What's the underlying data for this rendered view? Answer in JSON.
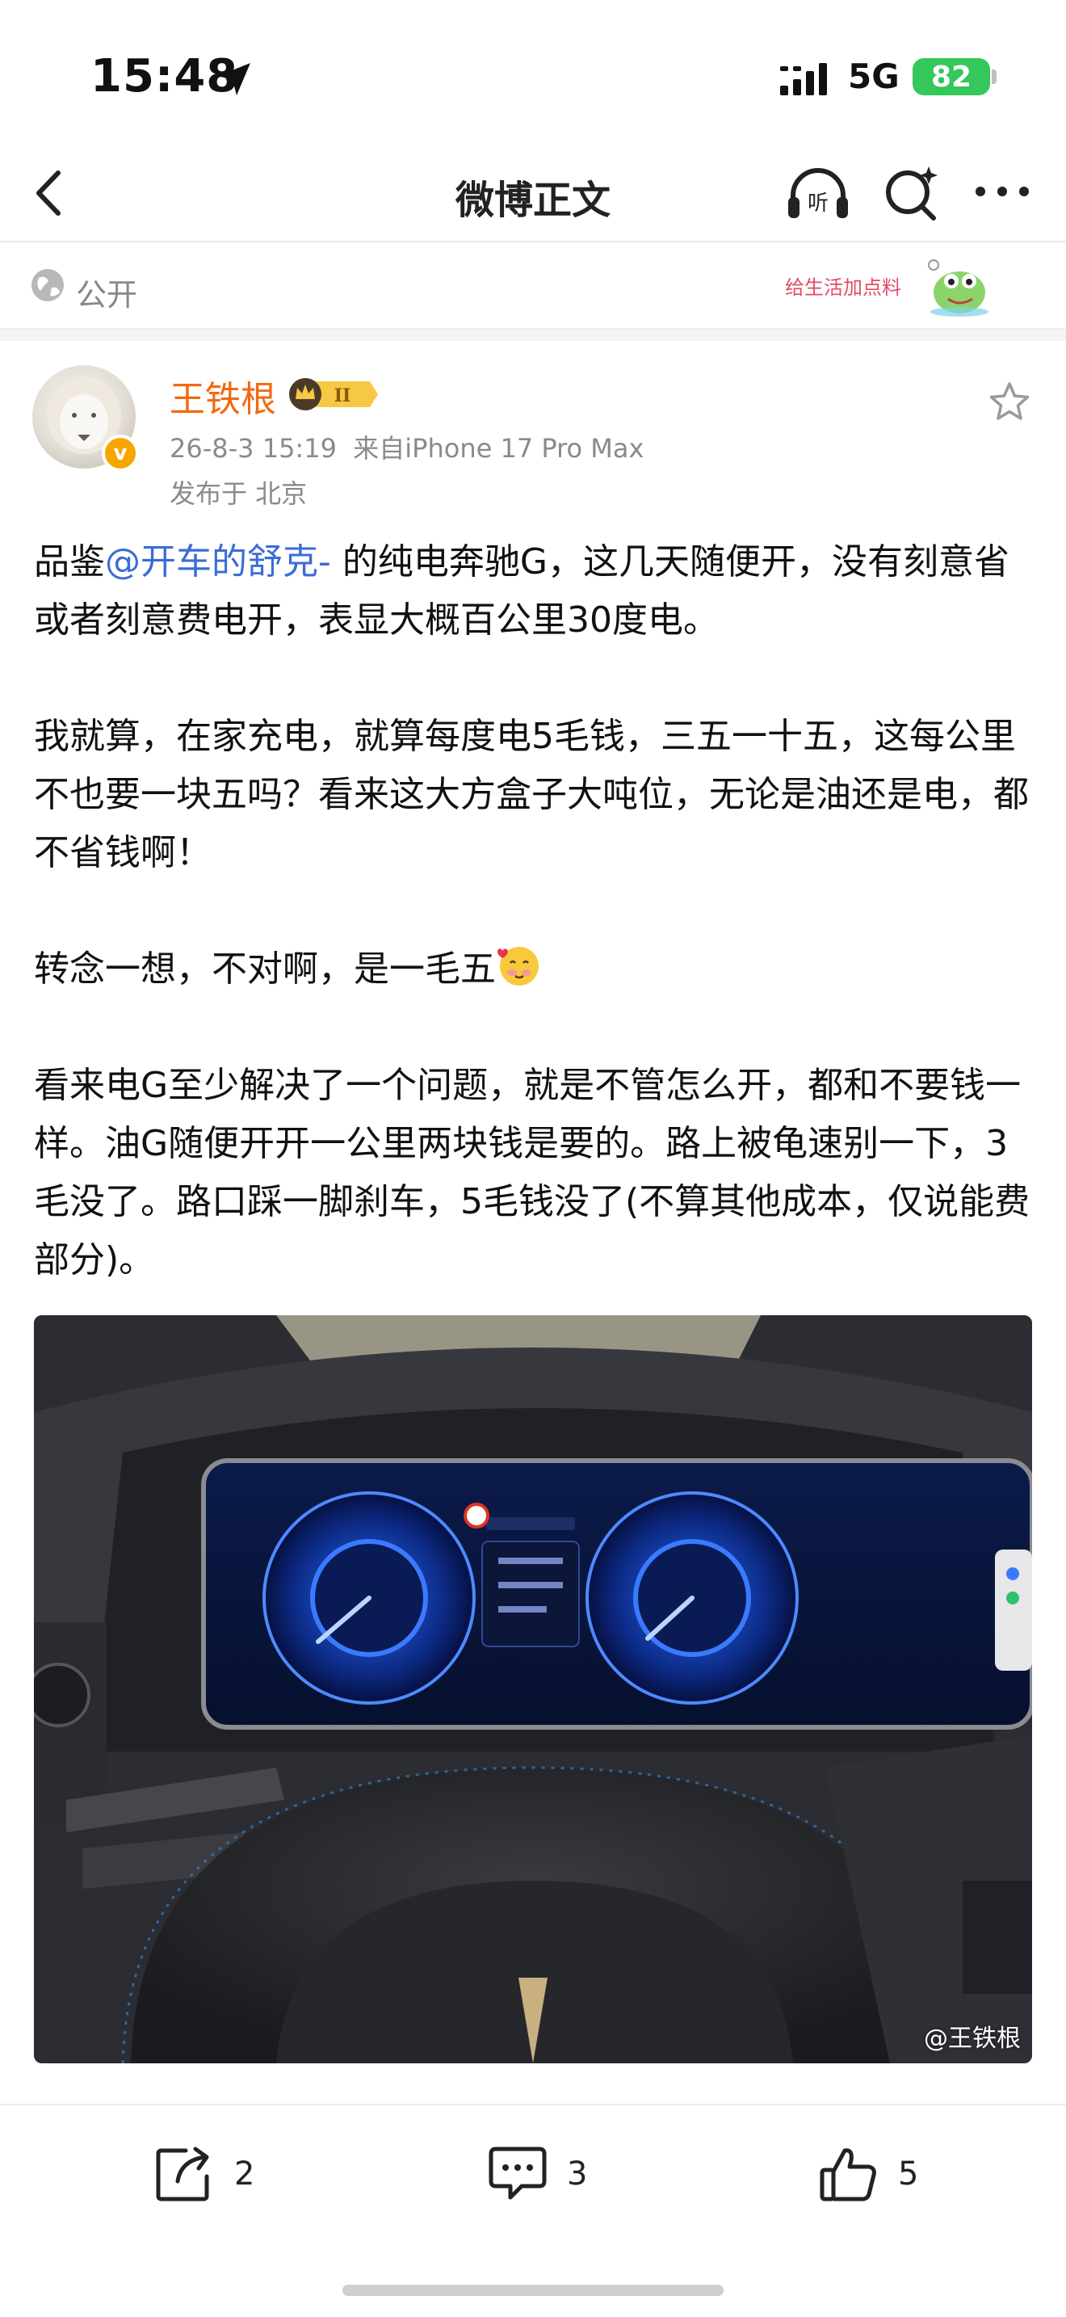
{
  "status_bar": {
    "time": "15:48",
    "network": "5G",
    "battery": "82"
  },
  "nav": {
    "title": "微博正文",
    "listen_label": "听"
  },
  "visibility": {
    "label": "公开",
    "sticker_text": "给生活加点料"
  },
  "author": {
    "name": "王铁根",
    "level_badge": "II",
    "verified_badge": "v",
    "timestamp": "26-8-3 15:19",
    "source": "来自iPhone 17 Pro Max",
    "location": "发布于 北京"
  },
  "post": {
    "p1_prefix": "品鉴",
    "p1_mention": "@开车的舒克-",
    "p1_suffix": " 的纯电奔驰G，这几天随便开，没有刻意省或者刻意费电开，表显大概百公里30度电。",
    "p2": "我就算，在家充电，就算每度电5毛钱，三五一十五，这每公里不也要一块五吗？看来这大方盒子大吨位，无论是油还是电，都不省钱啊！",
    "p3": "转念一想，不对啊，是一毛五",
    "p3_emoji": "smiling-face-with-hearts",
    "p4": "看来电G至少解决了一个问题，就是不管怎么开，都和不要钱一样。油G随便开开一公里两块钱是要的。路上被龟速别一下，3毛没了。路口踩一脚刹车，5毛钱没了(不算其他成本，仅说能费部分)。",
    "image_watermark": "@王铁根"
  },
  "actions": {
    "repost_count": "2",
    "comment_count": "3",
    "like_count": "5"
  },
  "colors": {
    "name": "#f26a0f",
    "mention": "#3b6cd6",
    "battery": "#34c759"
  }
}
